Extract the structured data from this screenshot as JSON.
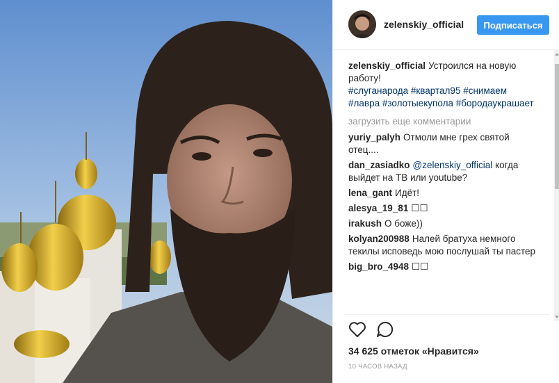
{
  "post": {
    "username": "zelenskiy_official",
    "follow_label": "Подписаться",
    "caption": {
      "user": "zelenskiy_official",
      "text": "Устроился на новую работу!",
      "tags": [
        "#слуганарода",
        "#квартал95",
        "#снимаем",
        "#лавра",
        "#золотыекупола",
        "#бородаукрашает"
      ]
    },
    "load_more_label": "загрузить еще комментарии",
    "comments": [
      {
        "user": "yuriy_palyh",
        "mention": "",
        "text": "Отмоли мне грех святой отец...."
      },
      {
        "user": "dan_zasiadko",
        "mention": "@zelenskiy_official",
        "text": "когда выйдет на ТВ или youtube?"
      },
      {
        "user": "lena_gant",
        "mention": "",
        "text": "Идёт!"
      },
      {
        "user": "alesya_19_81",
        "mention": "",
        "text": "☐☐"
      },
      {
        "user": "irakush",
        "mention": "",
        "text": "О боже))"
      },
      {
        "user": "kolyan200988",
        "mention": "",
        "text": "Налей братуха немного текилы исповедь мою послушай ты пастер"
      },
      {
        "user": "big_bro_4948",
        "mention": "",
        "text": "☐☐"
      }
    ],
    "likes_text": "34 625 отметок «Нравится»",
    "time_text": "10 ЧАСОВ НАЗАД",
    "icons": {
      "like": "heart-icon",
      "comment": "comment-icon"
    },
    "colors": {
      "follow": "#3897f0",
      "hashtag": "#003569",
      "muted": "#999999"
    }
  }
}
